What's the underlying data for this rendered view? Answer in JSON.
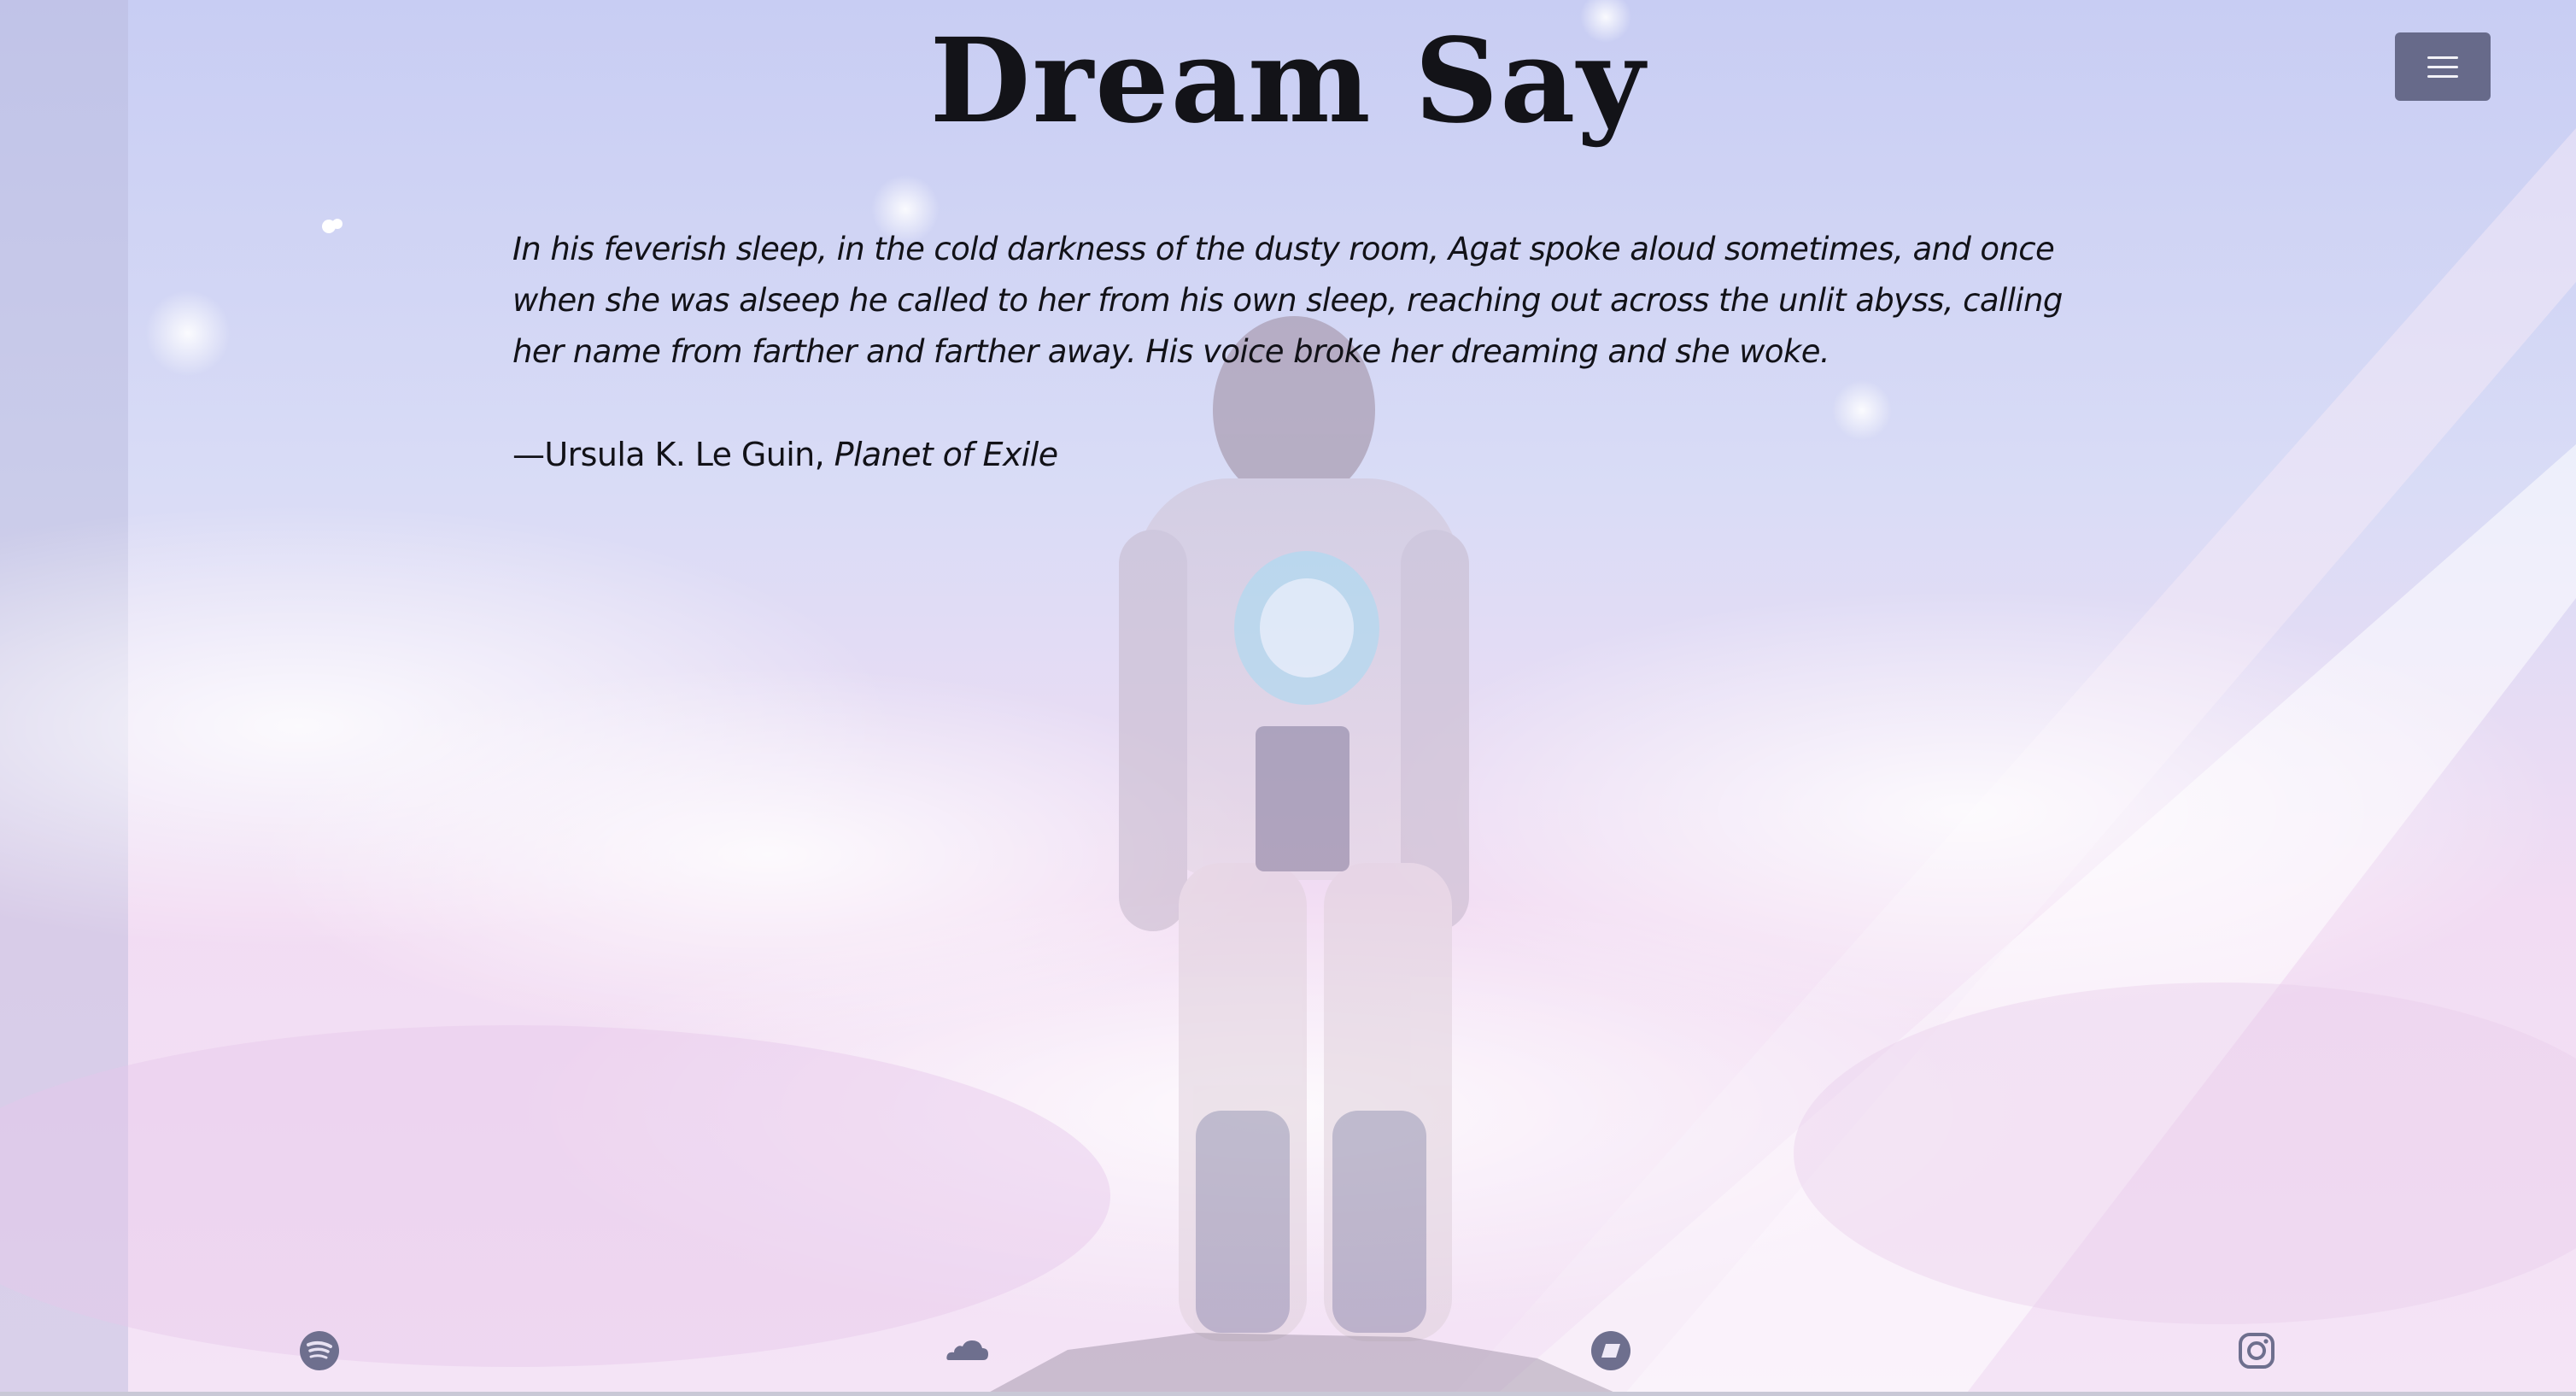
{
  "site": {
    "title": "Dream Say"
  },
  "menu": {
    "icon": "hamburger-icon"
  },
  "quote": {
    "text": "In his feverish sleep, in the cold darkness of the dusty room, Agat spoke aloud sometimes, and once when she was alseep he called to her from his own sleep, reaching out across the unlit abyss, calling her name from farther and farther away. His voice broke her dreaming and she woke.",
    "author": "—Ursula K. Le Guin, ",
    "work": "Planet of Exile"
  },
  "social": [
    {
      "icon": "spotify-icon"
    },
    {
      "icon": "soundcloud-icon"
    },
    {
      "icon": "bandcamp-icon"
    },
    {
      "icon": "instagram-icon"
    }
  ],
  "colors": {
    "title": "#131318",
    "menu_button": "#676a8a",
    "icon": "#6e6f8e",
    "sky_top": "#c6cdf2",
    "sky_bottom": "#f6dcf4"
  }
}
